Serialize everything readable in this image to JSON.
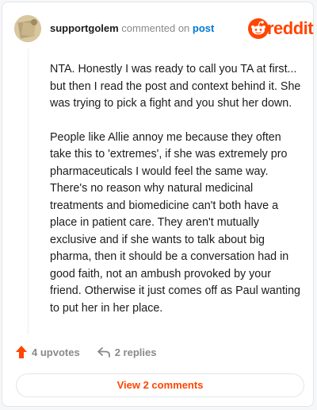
{
  "header": {
    "username": "supportgolem",
    "action_text": "commented on",
    "post_link": "post",
    "brand": "reddit"
  },
  "comment": {
    "paragraphs": [
      "NTA. Honestly I was ready to call you TA at first... but then I read the post and context behind it. She was trying to pick a fight and you shut her down.",
      "People like Allie annoy me because they often take this to 'extremes', if she was extremely pro pharmaceuticals I would feel the same way. There's no reason why natural medicinal treatments and biomedicine can't both have a place in patient care. They aren't mutually exclusive and if she wants to talk about big pharma, then it should be a conversation had in good faith, not an ambush provoked by your friend. Otherwise it just comes off as Paul wanting to put her in her place."
    ]
  },
  "actions": {
    "upvotes": "4 upvotes",
    "replies": "2 replies"
  },
  "footer": {
    "view_comments": "View 2 comments"
  },
  "colors": {
    "accent": "#ff4500",
    "link": "#0079d3",
    "muted": "#878a8c",
    "text": "#1c1c1c"
  },
  "icons": {
    "upvote": "upvote-arrow-icon",
    "reply": "reply-arrow-icon",
    "logo": "reddit-snoo-icon"
  }
}
